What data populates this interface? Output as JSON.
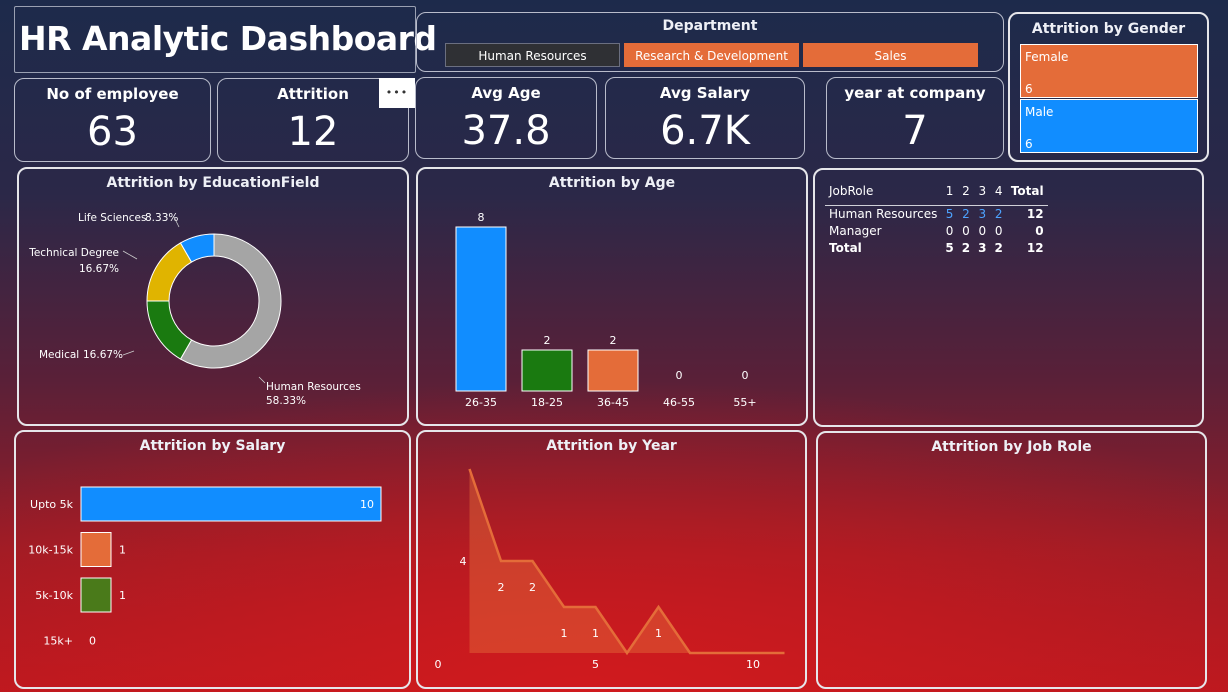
{
  "dashboard_title": "HR Analytic Dashboard",
  "department": {
    "title": "Department",
    "options": [
      "Human Resources",
      "Research & Development",
      "Sales"
    ],
    "option_colors": [
      "#2f3034",
      "#e46c39",
      "#e46c39"
    ]
  },
  "kpis": {
    "employees": {
      "label": "No of employee",
      "value": "63"
    },
    "attrition": {
      "label": "Attrition",
      "value": "12"
    },
    "avg_age": {
      "label": "Avg Age",
      "value": "37.8"
    },
    "avg_salary": {
      "label": "Avg Salary",
      "value": "6.7K"
    },
    "years": {
      "label": "year at company",
      "value": "7"
    }
  },
  "more_options_glyph": "•••",
  "colors": {
    "blue": "#118dff",
    "orange": "#e46c39",
    "green": "#1a7a10",
    "yellow": "#e0b400",
    "gray": "#a5a5a5",
    "salary_green": "#4a7a1a"
  },
  "chart_data": [
    {
      "id": "gender",
      "type": "bar",
      "title": "Attrition by Gender",
      "categories": [
        "Female",
        "Male"
      ],
      "values": [
        6,
        6
      ]
    },
    {
      "id": "education",
      "type": "pie",
      "title": "Attrition by EducationField",
      "categories": [
        "Human Resources",
        "Medical",
        "Technical Degree",
        "Life Sciences"
      ],
      "values": [
        58.33,
        16.67,
        16.67,
        8.33
      ],
      "labels": [
        {
          "name": "Human Resources",
          "pct": "58.33%"
        },
        {
          "name": "Medical",
          "pct": "16.67%"
        },
        {
          "name": "Technical Degree",
          "pct": "16.67%"
        },
        {
          "name": "Life Sciences",
          "pct": "8.33%"
        }
      ]
    },
    {
      "id": "age",
      "type": "bar",
      "title": "Attrition by Age",
      "categories": [
        "26-35",
        "18-25",
        "36-45",
        "46-55",
        "55+"
      ],
      "values": [
        8,
        2,
        2,
        0,
        0
      ]
    },
    {
      "id": "jobrole_matrix",
      "type": "table",
      "columns": [
        "JobRole",
        "1",
        "2",
        "3",
        "4",
        "Total"
      ],
      "rows": [
        {
          "cells": [
            "Human Resources",
            "5",
            "2",
            "3",
            "2",
            "12"
          ]
        },
        {
          "cells": [
            "Manager",
            "0",
            "0",
            "0",
            "0",
            "0"
          ]
        },
        {
          "cells": [
            "Total",
            "5",
            "2",
            "3",
            "2",
            "12"
          ]
        }
      ]
    },
    {
      "id": "salary",
      "type": "bar",
      "orientation": "horizontal",
      "title": "Attrition by Salary",
      "categories": [
        "Upto 5k",
        "10k-15k",
        "5k-10k",
        "15k+"
      ],
      "values": [
        10,
        1,
        1,
        0
      ]
    },
    {
      "id": "year",
      "type": "area",
      "title": "Attrition by Year",
      "x": [
        1,
        2,
        3,
        4,
        5,
        6,
        7,
        8,
        9,
        10,
        11
      ],
      "y": [
        4,
        2,
        2,
        1,
        1,
        0,
        1,
        0,
        0,
        0,
        0
      ],
      "x_ticks": [
        0,
        5,
        10
      ],
      "xlim": [
        0,
        11
      ]
    },
    {
      "id": "jobrole_chart",
      "type": "bar",
      "title": "Attrition by Job Role",
      "categories": [],
      "values": []
    }
  ]
}
